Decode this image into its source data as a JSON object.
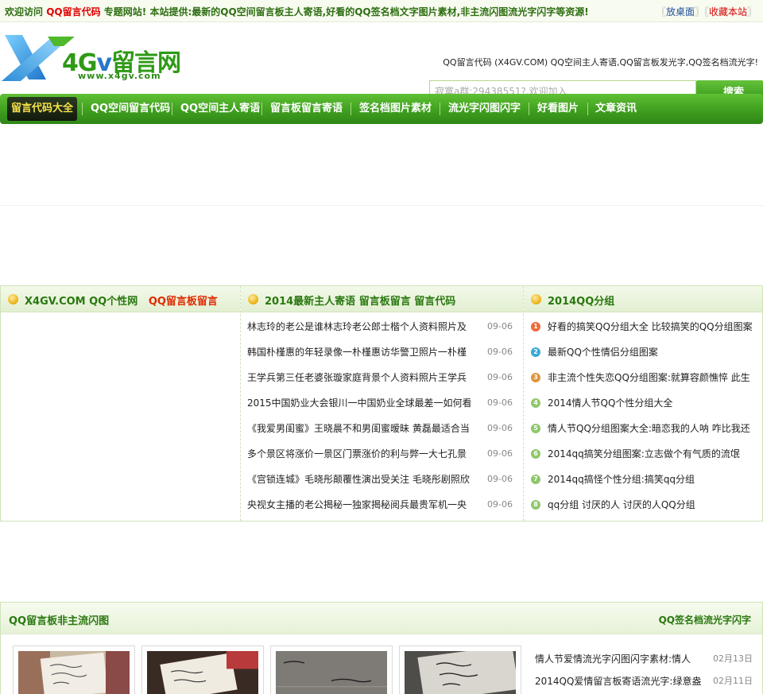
{
  "topbar": {
    "welcome": "欢迎访问",
    "brand": "QQ留言代码",
    "after_brand": "专题网站!",
    "desc": "本站提供:最新的QQ空间留言板主人寄语,好看的QQ签名档文字图片素材,非主流闪图流光字闪字等资源!",
    "put_desktop": "放桌面",
    "bookmark": "收藏本站"
  },
  "header": {
    "logo_brand_left": "4G",
    "logo_brand_v": "v",
    "logo_brand_right": "留言网",
    "logo_url": "www.x4gv.com",
    "slogan": "QQ留言代码 (X4GV.COM) QQ空间主人寄语,QQ留言板发光字,QQ签名档流光字!",
    "search_placeholder": "寂寞a群:29438551?,欢迎加入",
    "search_button": "搜索"
  },
  "nav": {
    "items": [
      {
        "label": "留言代码大全"
      },
      {
        "label": "QQ空间留言代码"
      },
      {
        "label": "QQ空间主人寄语"
      },
      {
        "label": "留言板留言寄语"
      },
      {
        "label": "签名档图片素材"
      },
      {
        "label": "流光字闪图闪字"
      },
      {
        "label": "好看图片"
      },
      {
        "label": "文章资讯"
      }
    ]
  },
  "panel": {
    "col1": {
      "title_main": "X4GV.COM QQ个性网",
      "title_red": "QQ留言板留言"
    },
    "col2": {
      "title": "2014最新主人寄语 留言板留言 留言代码",
      "items": [
        {
          "title": "林志玲的老公是谁林志玲老公郎士楷个人资料照片及",
          "date": "09-06"
        },
        {
          "title": "韩国朴槿惠的年轻录像一朴槿惠访华警卫照片一朴槿",
          "date": "09-06"
        },
        {
          "title": "王学兵第三任老婆张璇家庭背景个人资料照片王学兵",
          "date": "09-06"
        },
        {
          "title": "2015中国奶业大会银川一中国奶业全球最差一如何看",
          "date": "09-06"
        },
        {
          "title": "《我爱男闺蜜》王晓晨不和男闺蜜暧昧 黄磊最适合当",
          "date": "09-06"
        },
        {
          "title": "多个景区将涨价一景区门票涨价的利与弊一大七孔景",
          "date": "09-06"
        },
        {
          "title": "《宫锁连城》毛晓彤颠覆性演出受关注 毛晓彤剧照欣",
          "date": "09-06"
        },
        {
          "title": "央视女主播的老公揭秘一独家揭秘阅兵最贵军机一央",
          "date": "09-06"
        }
      ]
    },
    "col3": {
      "title": "2014QQ分组",
      "items": [
        {
          "num": "1",
          "title": "好看的搞笑QQ分组大全 比较搞笑的QQ分组图案"
        },
        {
          "num": "2",
          "title": "最新QQ个性情侣分组图案"
        },
        {
          "num": "3",
          "title": "非主流个性失恋QQ分组图案:就算容颜憔悴 此生"
        },
        {
          "num": "4",
          "title": "2014情人节QQ个性分组大全"
        },
        {
          "num": "5",
          "title": "情人节QQ分组图案大全:暗恋我的人呐 咋比我还"
        },
        {
          "num": "6",
          "title": "2014qq搞笑分组图案:立志做个有气质的流氓"
        },
        {
          "num": "7",
          "title": "2014qq搞怪个性分组:搞笑qq分组"
        },
        {
          "num": "8",
          "title": "qq分组 讨厌的人 讨厌的人QQ分组"
        }
      ]
    }
  },
  "lower": {
    "title": "QQ留言板非主流闪图",
    "more": "QQ签名档流光字闪字",
    "items": [
      {
        "title": "情人节爱情流光字闪图闪字素材:情人",
        "date": "02月13日"
      },
      {
        "title": "2014QQ爱情留言板寄语流光字:绿意盎",
        "date": "02月11日"
      }
    ]
  },
  "colors": {
    "brand_green": "#3f9f1f",
    "accent_red": "#e00000",
    "nav_active_text": "#f6e14a"
  }
}
